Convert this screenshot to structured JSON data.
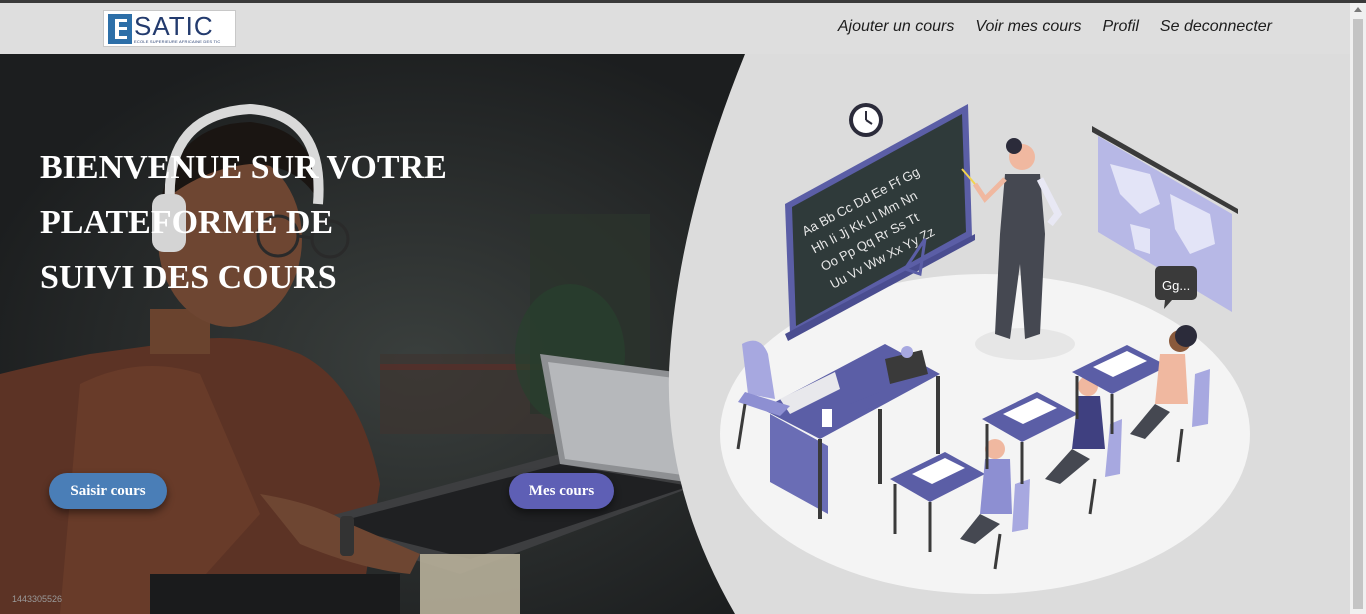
{
  "navbar": {
    "logo": {
      "text": "SATIC",
      "subtitle": "ECOLE SUPERIEURE AFRICAINE DES TIC"
    },
    "links": [
      "Ajouter un cours",
      "Voir mes cours",
      "Profil",
      "Se deconnecter"
    ]
  },
  "hero": {
    "title_lines": [
      "BIENVENUE SUR VOTRE",
      "PLATEFORME DE",
      "SUIVI DES COURS"
    ],
    "buttons": {
      "saisir": "Saisir cours",
      "mes": "Mes cours"
    },
    "watermark": "1443305526",
    "illustration": {
      "clock": "clock-icon",
      "alphabet_rows": [
        "Aa Bb Cc Dd Ee Ff Gg",
        "Hh Ii Jj Kk Ll Mm Nn",
        "Oo Pp Qq Rr Ss Tt",
        "Uu Vv Ww Xx Yy Zz"
      ],
      "speech_bubble": "Gg..."
    }
  },
  "colors": {
    "navbar_bg": "#dedede",
    "panel_bg": "#dcdcdc",
    "accent_purple": "#5e5fb5",
    "button_blue": "#4a7eb7"
  }
}
